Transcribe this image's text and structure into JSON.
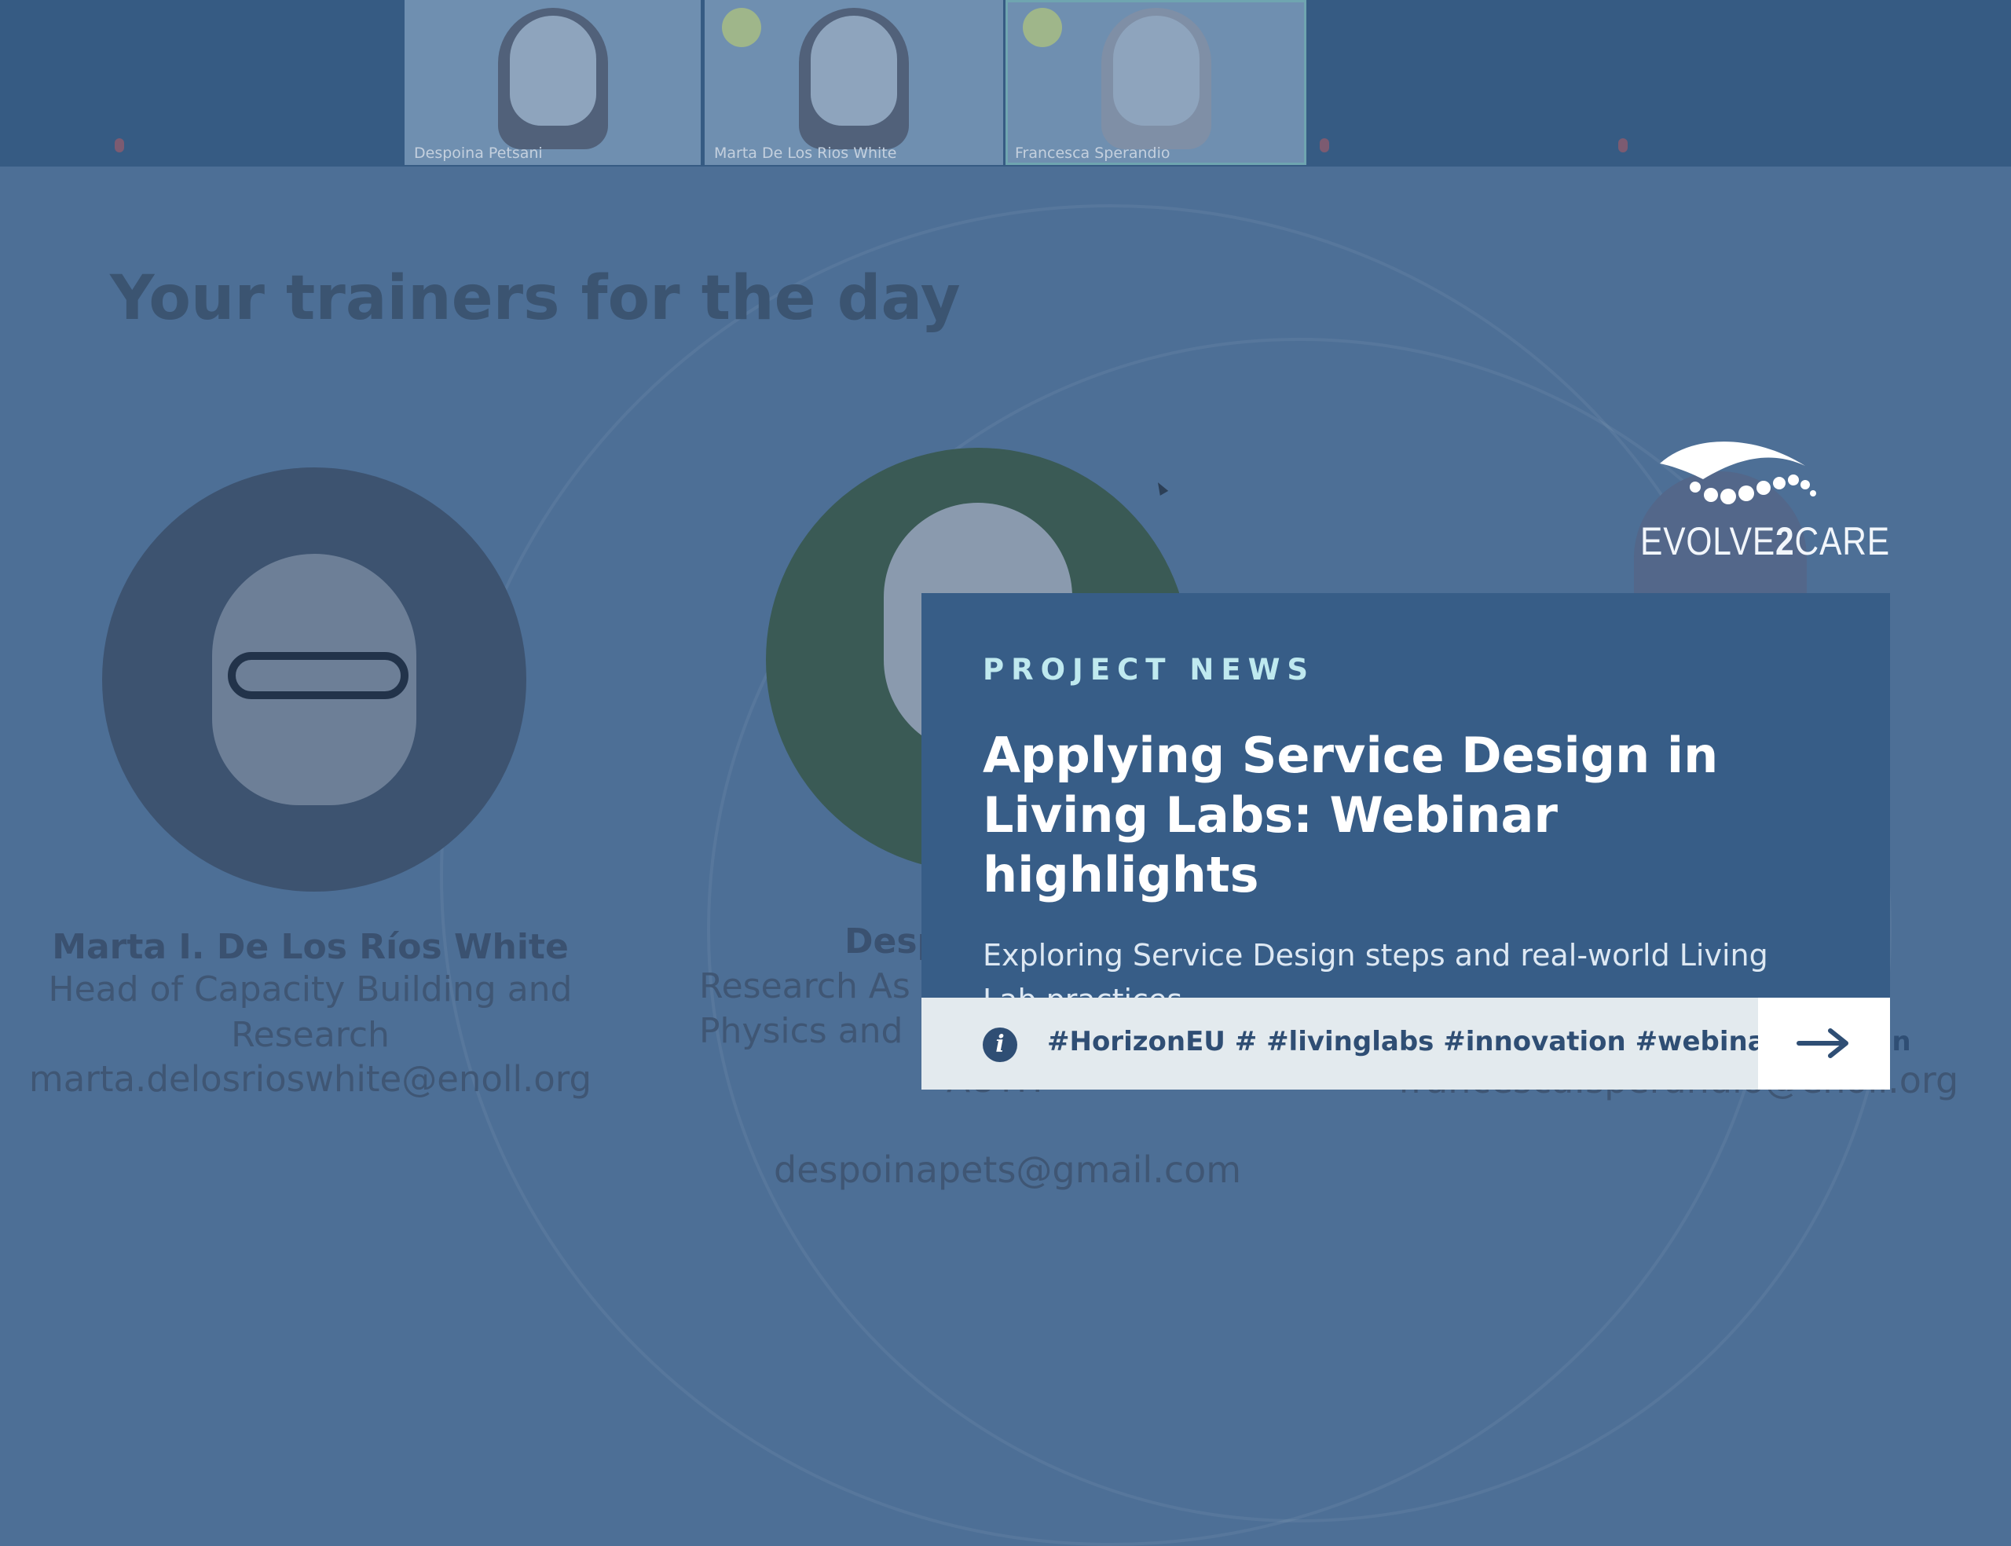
{
  "meeting": {
    "participants": [
      {
        "name": "Despoina Petsani"
      },
      {
        "name": "Marta De Los Rios White"
      },
      {
        "name": "Francesca Sperandio"
      }
    ]
  },
  "slide": {
    "title": "Your trainers for the day",
    "trainers": [
      {
        "name": "Marta I. De Los Ríos White",
        "role_line1": "Head of Capacity Building and",
        "role_line2": "Research",
        "email": "marta.delosrioswhite@enoll.org"
      },
      {
        "name_partial": "Desp",
        "role_line1_partial": "Research As",
        "role_line2_partial": "Physics and",
        "org_partial": "AUTH",
        "email": "despoinapets@gmail.com"
      },
      {
        "email_partial": "francesca.sperandio@enoll.org"
      }
    ]
  },
  "brand": {
    "name_prefix": "EVOLVE",
    "name_number": "2",
    "name_suffix": "CARE"
  },
  "card": {
    "kicker": "PROJECT NEWS",
    "headline": "Applying Service Design in Living Labs: Webinar highlights",
    "subheading": "Exploring Service Design steps and real-world Living Lab practices",
    "tags": "#HorizonEU # #livinglabs #innovation #webinar #design"
  },
  "colors": {
    "card_bg": "#375d87",
    "kicker": "#bfe9ef",
    "bar_bg": "#e3eaee",
    "overlay": "#4d6f96"
  },
  "icons": {
    "info": "info-icon",
    "next": "arrow-right-icon"
  }
}
